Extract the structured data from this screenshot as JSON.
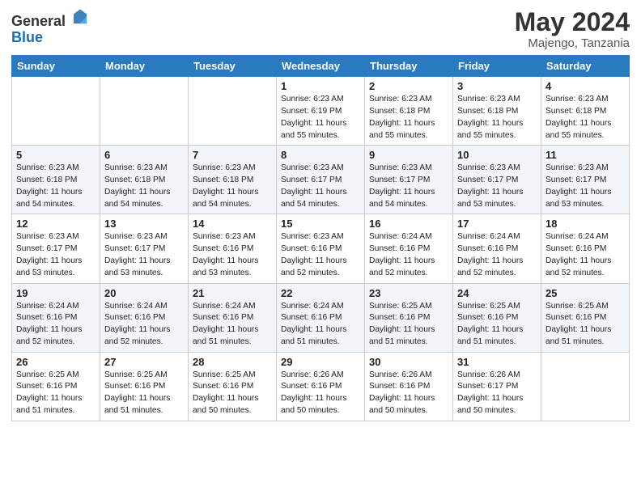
{
  "logo": {
    "general": "General",
    "blue": "Blue"
  },
  "header": {
    "title": "May 2024",
    "location": "Majengo, Tanzania"
  },
  "weekdays": [
    "Sunday",
    "Monday",
    "Tuesday",
    "Wednesday",
    "Thursday",
    "Friday",
    "Saturday"
  ],
  "weeks": [
    [
      {
        "day": "",
        "info": ""
      },
      {
        "day": "",
        "info": ""
      },
      {
        "day": "",
        "info": ""
      },
      {
        "day": "1",
        "info": "Sunrise: 6:23 AM\nSunset: 6:19 PM\nDaylight: 11 hours\nand 55 minutes."
      },
      {
        "day": "2",
        "info": "Sunrise: 6:23 AM\nSunset: 6:18 PM\nDaylight: 11 hours\nand 55 minutes."
      },
      {
        "day": "3",
        "info": "Sunrise: 6:23 AM\nSunset: 6:18 PM\nDaylight: 11 hours\nand 55 minutes."
      },
      {
        "day": "4",
        "info": "Sunrise: 6:23 AM\nSunset: 6:18 PM\nDaylight: 11 hours\nand 55 minutes."
      }
    ],
    [
      {
        "day": "5",
        "info": "Sunrise: 6:23 AM\nSunset: 6:18 PM\nDaylight: 11 hours\nand 54 minutes."
      },
      {
        "day": "6",
        "info": "Sunrise: 6:23 AM\nSunset: 6:18 PM\nDaylight: 11 hours\nand 54 minutes."
      },
      {
        "day": "7",
        "info": "Sunrise: 6:23 AM\nSunset: 6:18 PM\nDaylight: 11 hours\nand 54 minutes."
      },
      {
        "day": "8",
        "info": "Sunrise: 6:23 AM\nSunset: 6:17 PM\nDaylight: 11 hours\nand 54 minutes."
      },
      {
        "day": "9",
        "info": "Sunrise: 6:23 AM\nSunset: 6:17 PM\nDaylight: 11 hours\nand 54 minutes."
      },
      {
        "day": "10",
        "info": "Sunrise: 6:23 AM\nSunset: 6:17 PM\nDaylight: 11 hours\nand 53 minutes."
      },
      {
        "day": "11",
        "info": "Sunrise: 6:23 AM\nSunset: 6:17 PM\nDaylight: 11 hours\nand 53 minutes."
      }
    ],
    [
      {
        "day": "12",
        "info": "Sunrise: 6:23 AM\nSunset: 6:17 PM\nDaylight: 11 hours\nand 53 minutes."
      },
      {
        "day": "13",
        "info": "Sunrise: 6:23 AM\nSunset: 6:17 PM\nDaylight: 11 hours\nand 53 minutes."
      },
      {
        "day": "14",
        "info": "Sunrise: 6:23 AM\nSunset: 6:16 PM\nDaylight: 11 hours\nand 53 minutes."
      },
      {
        "day": "15",
        "info": "Sunrise: 6:23 AM\nSunset: 6:16 PM\nDaylight: 11 hours\nand 52 minutes."
      },
      {
        "day": "16",
        "info": "Sunrise: 6:24 AM\nSunset: 6:16 PM\nDaylight: 11 hours\nand 52 minutes."
      },
      {
        "day": "17",
        "info": "Sunrise: 6:24 AM\nSunset: 6:16 PM\nDaylight: 11 hours\nand 52 minutes."
      },
      {
        "day": "18",
        "info": "Sunrise: 6:24 AM\nSunset: 6:16 PM\nDaylight: 11 hours\nand 52 minutes."
      }
    ],
    [
      {
        "day": "19",
        "info": "Sunrise: 6:24 AM\nSunset: 6:16 PM\nDaylight: 11 hours\nand 52 minutes."
      },
      {
        "day": "20",
        "info": "Sunrise: 6:24 AM\nSunset: 6:16 PM\nDaylight: 11 hours\nand 52 minutes."
      },
      {
        "day": "21",
        "info": "Sunrise: 6:24 AM\nSunset: 6:16 PM\nDaylight: 11 hours\nand 51 minutes."
      },
      {
        "day": "22",
        "info": "Sunrise: 6:24 AM\nSunset: 6:16 PM\nDaylight: 11 hours\nand 51 minutes."
      },
      {
        "day": "23",
        "info": "Sunrise: 6:25 AM\nSunset: 6:16 PM\nDaylight: 11 hours\nand 51 minutes."
      },
      {
        "day": "24",
        "info": "Sunrise: 6:25 AM\nSunset: 6:16 PM\nDaylight: 11 hours\nand 51 minutes."
      },
      {
        "day": "25",
        "info": "Sunrise: 6:25 AM\nSunset: 6:16 PM\nDaylight: 11 hours\nand 51 minutes."
      }
    ],
    [
      {
        "day": "26",
        "info": "Sunrise: 6:25 AM\nSunset: 6:16 PM\nDaylight: 11 hours\nand 51 minutes."
      },
      {
        "day": "27",
        "info": "Sunrise: 6:25 AM\nSunset: 6:16 PM\nDaylight: 11 hours\nand 51 minutes."
      },
      {
        "day": "28",
        "info": "Sunrise: 6:25 AM\nSunset: 6:16 PM\nDaylight: 11 hours\nand 50 minutes."
      },
      {
        "day": "29",
        "info": "Sunrise: 6:26 AM\nSunset: 6:16 PM\nDaylight: 11 hours\nand 50 minutes."
      },
      {
        "day": "30",
        "info": "Sunrise: 6:26 AM\nSunset: 6:16 PM\nDaylight: 11 hours\nand 50 minutes."
      },
      {
        "day": "31",
        "info": "Sunrise: 6:26 AM\nSunset: 6:17 PM\nDaylight: 11 hours\nand 50 minutes."
      },
      {
        "day": "",
        "info": ""
      }
    ]
  ]
}
